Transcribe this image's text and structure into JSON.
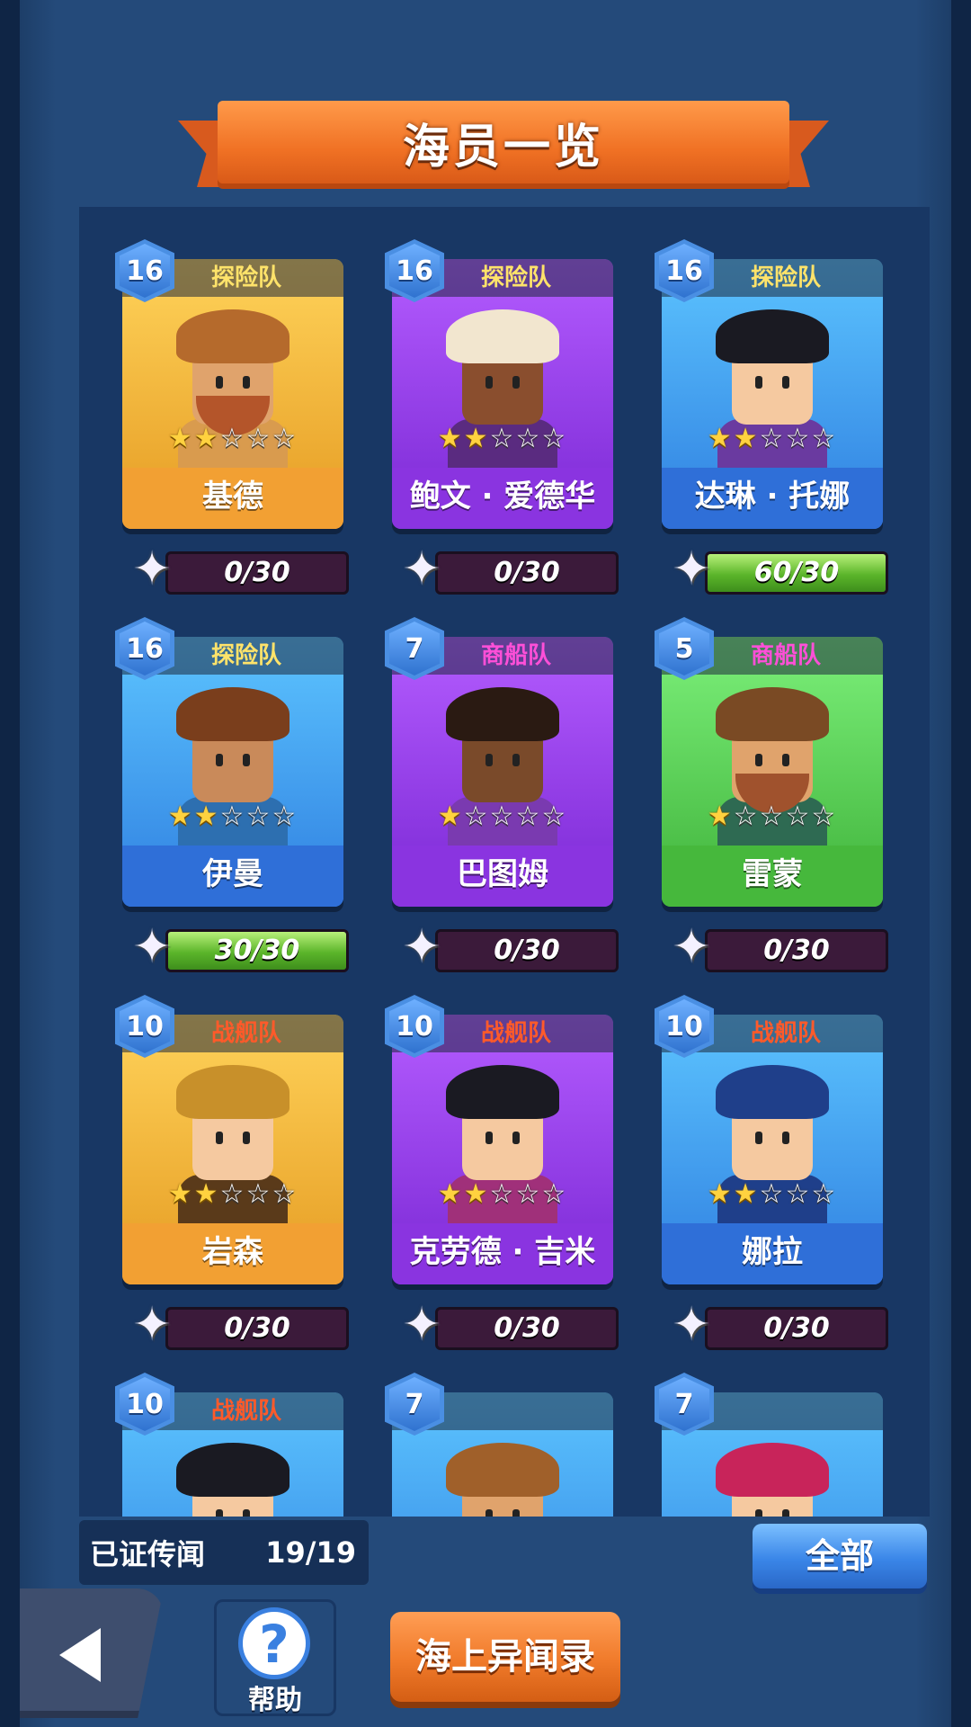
{
  "title": "海员一览",
  "cards": [
    {
      "level": "16",
      "team": "探险队",
      "team_color": "#ffe36a",
      "name": "基德",
      "stars": 2,
      "progress_text": "0/30",
      "progress_fill": 0,
      "theme": "orange",
      "hat": "#b56a2c",
      "body": "#d99b4e",
      "beard": "#b4552a",
      "skin": "#e0a36c"
    },
    {
      "level": "16",
      "team": "探险队",
      "team_color": "#ffe36a",
      "name": "鲍文 · 爱德华",
      "stars": 2,
      "progress_text": "0/30",
      "progress_fill": 0,
      "theme": "purple",
      "hat": "#f2e6cf",
      "body": "#5a2b80",
      "beard": "",
      "skin": "#8a4e2e"
    },
    {
      "level": "16",
      "team": "探险队",
      "team_color": "#ffe36a",
      "name": "达琳 · 托娜",
      "stars": 2,
      "progress_text": "60/30",
      "progress_fill": 1,
      "theme": "blue",
      "hat": "#1a1a22",
      "body": "#6a3aa0",
      "beard": "",
      "skin": "#f5c9a0"
    },
    {
      "level": "16",
      "team": "探险队",
      "team_color": "#ffe36a",
      "name": "伊曼",
      "stars": 2,
      "progress_text": "30/30",
      "progress_fill": 1,
      "theme": "blue",
      "hat": "#7a3e1c",
      "body": "#2d6fb0",
      "beard": "",
      "skin": "#c98a5a"
    },
    {
      "level": "7",
      "team": "商船队",
      "team_color": "#ff4fd8",
      "name": "巴图姆",
      "stars": 1,
      "progress_text": "0/30",
      "progress_fill": 0,
      "theme": "purple",
      "hat": "#2a1a12",
      "body": "#7a3ab0",
      "beard": "",
      "skin": "#7a4a2a"
    },
    {
      "level": "5",
      "team": "商船队",
      "team_color": "#ff4fd8",
      "name": "雷蒙",
      "stars": 1,
      "progress_text": "0/30",
      "progress_fill": 0,
      "theme": "green",
      "hat": "#7a4a24",
      "body": "#2e6a52",
      "beard": "#a0522d",
      "skin": "#e0a36c"
    },
    {
      "level": "10",
      "team": "战舰队",
      "team_color": "#ff5a2a",
      "name": "岩森",
      "stars": 2,
      "progress_text": "0/30",
      "progress_fill": 0,
      "theme": "orange",
      "hat": "#c8902a",
      "body": "#5a3a1a",
      "beard": "",
      "skin": "#f5c9a0"
    },
    {
      "level": "10",
      "team": "战舰队",
      "team_color": "#ff5a2a",
      "name": "克劳德 · 吉米",
      "stars": 2,
      "progress_text": "0/30",
      "progress_fill": 0,
      "theme": "purple",
      "hat": "#1a1a22",
      "body": "#a0307a",
      "beard": "",
      "skin": "#f5c9a0"
    },
    {
      "level": "10",
      "team": "战舰队",
      "team_color": "#ff5a2a",
      "name": "娜拉",
      "stars": 2,
      "progress_text": "0/30",
      "progress_fill": 0,
      "theme": "blue",
      "hat": "#1f3f8a",
      "body": "#1f3f8a",
      "beard": "",
      "skin": "#f5c9a0"
    },
    {
      "level": "10",
      "team": "战舰队",
      "team_color": "#ff5a2a",
      "name": "",
      "stars": 0,
      "progress_text": "",
      "progress_fill": 0,
      "theme": "blue",
      "hat": "#1a1a22",
      "body": "#333",
      "beard": "",
      "skin": "#f5c9a0"
    },
    {
      "level": "7",
      "team": "",
      "team_color": "#ffffff",
      "name": "",
      "stars": 0,
      "progress_text": "",
      "progress_fill": 0,
      "theme": "blue",
      "hat": "#a0602a",
      "body": "#333",
      "beard": "#7a4a24",
      "skin": "#e0a36c"
    },
    {
      "level": "7",
      "team": "",
      "team_color": "#ffffff",
      "name": "",
      "stars": 0,
      "progress_text": "",
      "progress_fill": 0,
      "theme": "blue",
      "hat": "#c8245a",
      "body": "#333",
      "beard": "",
      "skin": "#f5c9a0"
    }
  ],
  "legend": {
    "label": "已证传闻",
    "count": "19/19"
  },
  "buttons": {
    "all": "全部",
    "help": "帮助",
    "sea_log": "海上异闻录"
  },
  "icons": {
    "back": "back-arrow-icon",
    "help": "question-mark-icon",
    "piece": "puzzle-piece-icon",
    "star": "star-icon"
  },
  "themes": {
    "orange": {
      "top": "#ffd35a",
      "bottom": "#e59b22",
      "bar": "#f2a033"
    },
    "purple": {
      "top": "#b45cff",
      "bottom": "#7a28d4",
      "bar": "#8a34e0"
    },
    "blue": {
      "top": "#5cc4ff",
      "bottom": "#2f7fe0",
      "bar": "#2f6fd8"
    },
    "green": {
      "top": "#7cf07a",
      "bottom": "#3fb23a",
      "bar": "#46b83c"
    }
  }
}
